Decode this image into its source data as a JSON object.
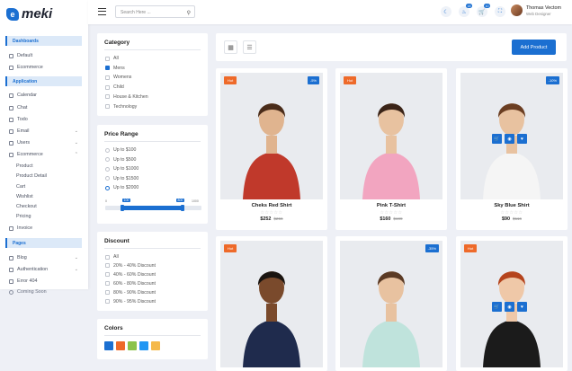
{
  "app": {
    "logo_text": "meki",
    "logo_letter": "e"
  },
  "sidebar": {
    "sections": [
      "Dashboards",
      "Application",
      "Pages"
    ],
    "dashboards": [
      {
        "label": "Default",
        "icon": "home-icon"
      },
      {
        "label": "Ecommerce",
        "icon": "monitor-icon"
      }
    ],
    "application": [
      {
        "label": "Calendar",
        "icon": "calendar-icon"
      },
      {
        "label": "Chat",
        "icon": "chat-icon"
      },
      {
        "label": "Todo",
        "icon": "todo-icon"
      },
      {
        "label": "Email",
        "icon": "mail-icon"
      },
      {
        "label": "Users",
        "icon": "users-icon"
      },
      {
        "label": "Ecommerce",
        "icon": "cart-icon"
      }
    ],
    "ecommerce_sub": [
      "Product",
      "Product Detail",
      "Cart",
      "Wishlist",
      "Checkout",
      "Pricing"
    ],
    "invoice": "Invoice",
    "pages": [
      {
        "label": "Blog",
        "icon": "blog-icon"
      },
      {
        "label": "Authentication",
        "icon": "lock-icon"
      },
      {
        "label": "Error 404",
        "icon": "error-icon"
      },
      {
        "label": "Coming Soon",
        "icon": "clock-icon"
      }
    ]
  },
  "topbar": {
    "search_placeholder": "Search Here ...",
    "badges": [
      "18",
      "10"
    ],
    "user_name": "Thomas Vectom",
    "user_role": "Web Designer"
  },
  "filters": {
    "category_title": "Category",
    "categories": [
      {
        "label": "All",
        "checked": false
      },
      {
        "label": "Mens",
        "checked": true
      },
      {
        "label": "Womens",
        "checked": false
      },
      {
        "label": "Child",
        "checked": false
      },
      {
        "label": "House & Kitchen",
        "checked": false
      },
      {
        "label": "Technology",
        "checked": false
      }
    ],
    "price_title": "Price Range",
    "prices": [
      {
        "label": "Up to $100",
        "checked": false
      },
      {
        "label": "Up to $500",
        "checked": false
      },
      {
        "label": "Up to $1000",
        "checked": false
      },
      {
        "label": "Up to $1500",
        "checked": false
      },
      {
        "label": "Up to $2000",
        "checked": true
      }
    ],
    "slider": {
      "min_label": "0",
      "max_label": "1000",
      "low_label": "100",
      "high_label": "800",
      "low": 0.18,
      "high": 0.8
    },
    "discount_title": "Discount",
    "discounts": [
      "All",
      "20% - 40% Discount",
      "40% - 60% Discount",
      "60% - 80% Discount",
      "80% - 90% Discount",
      "90% - 95% Discount"
    ],
    "colors_title": "Colors",
    "colors": [
      "#1b6fd1",
      "#ee6a2a",
      "#8bc34a",
      "#2196f3",
      "#f5b94a"
    ]
  },
  "toolbar": {
    "add_label": "Add Product"
  },
  "products": [
    {
      "name": "Cheks Red Shirt",
      "price": "$252",
      "old": "$256",
      "hot": "Hot",
      "discount": "-5%",
      "shirt": "#c0392b",
      "bg": "#e9ebef",
      "skin": "#e0b48f",
      "hair": "#4a2c1a"
    },
    {
      "name": "Pink T-Shirt",
      "price": "$160",
      "old": "$199",
      "hot": "Hot",
      "discount": "",
      "shirt": "#f2a5c0",
      "bg": "#e9ebef",
      "skin": "#e8c2a0",
      "hair": "#3b2418"
    },
    {
      "name": "Sky Blue Shirt",
      "price": "$90",
      "old": "$116",
      "hot": "",
      "discount": "-10%",
      "shirt": "#f5f5f5",
      "bg": "#e9ebef",
      "skin": "#e8c2a0",
      "hair": "#6b3e22"
    },
    {
      "name": "",
      "price": "",
      "old": "",
      "hot": "Hot",
      "discount": "",
      "shirt": "#1f2b4d",
      "bg": "#e9ebef",
      "skin": "#7a4a2c",
      "hair": "#1a1410"
    },
    {
      "name": "",
      "price": "",
      "old": "",
      "hot": "",
      "discount": "-35%",
      "shirt": "#bfe3dc",
      "bg": "#e9ebef",
      "skin": "#e8c2a0",
      "hair": "#5b3a24"
    },
    {
      "name": "",
      "price": "",
      "old": "",
      "hot": "Hot",
      "discount": "",
      "shirt": "#1b1b1b",
      "bg": "#e9ebef",
      "skin": "#efc8a8",
      "hair": "#b5441d"
    }
  ]
}
